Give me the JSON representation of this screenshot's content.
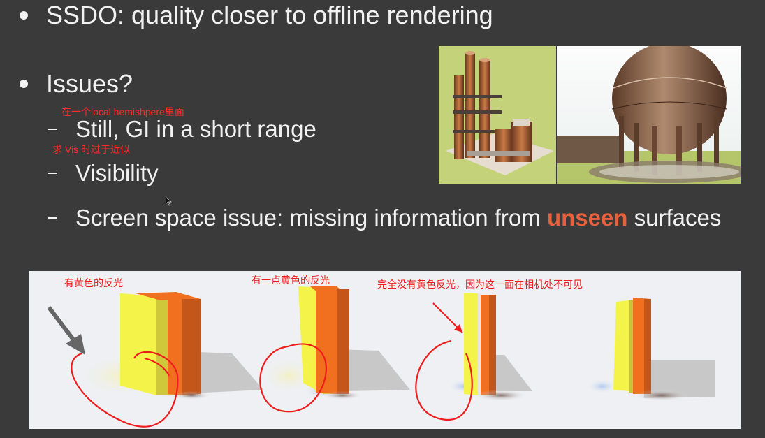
{
  "slide": {
    "title": "SSDO: quality closer to offline rendering",
    "issues_heading": "Issues?",
    "subitems": [
      {
        "text": "Still, GI in a short range",
        "note": "在一个local  hemishpere里面"
      },
      {
        "text": "Visibility",
        "note": "求 Vis 时过于近似"
      },
      {
        "pre": "Screen space issue: missing information from ",
        "highlight": "unseen",
        "post": " surfaces"
      }
    ]
  },
  "bottom_figure": {
    "annotations": [
      "有黄色的反光",
      "有一点黄色的反光",
      "完全没有黄色反光，因为这一面在相机处不可见"
    ]
  },
  "colors": {
    "background": "#3a3a3a",
    "text": "#f2f2f2",
    "highlight": "#e8603c",
    "annotation": "#ff2a2a",
    "panel_yellow": "#f3f34a",
    "panel_orange": "#f07020"
  }
}
